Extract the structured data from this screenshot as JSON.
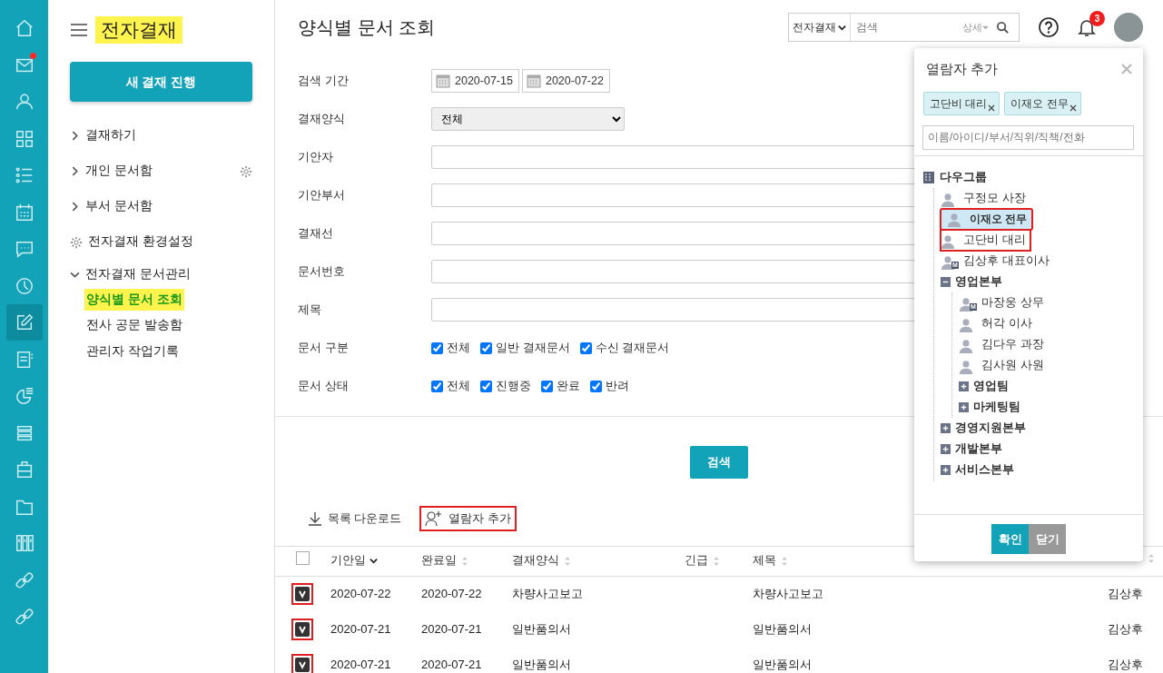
{
  "rail": [
    {
      "selected": false,
      "dot": false
    },
    {
      "selected": false,
      "dot": true
    },
    {
      "selected": false,
      "dot": false
    },
    {
      "selected": false,
      "dot": false
    },
    {
      "selected": false,
      "dot": false
    },
    {
      "selected": false,
      "dot": false
    },
    {
      "selected": false,
      "dot": false
    },
    {
      "selected": false,
      "dot": false
    },
    {
      "selected": true,
      "dot": false
    },
    {
      "selected": false,
      "dot": false
    },
    {
      "selected": false,
      "dot": false
    },
    {
      "selected": false,
      "dot": false
    },
    {
      "selected": false,
      "dot": false
    },
    {
      "selected": false,
      "dot": false
    },
    {
      "selected": false,
      "dot": false
    },
    {
      "selected": false,
      "dot": false
    },
    {
      "selected": false,
      "dot": false
    }
  ],
  "sidebar": {
    "title": "전자결재",
    "title_highlighted": true,
    "new_button": "새 결재 진행",
    "items": [
      {
        "kind": "folder",
        "label": "결재하기",
        "expanded": false
      },
      {
        "kind": "folder",
        "label": "개인 문서함",
        "expanded": false,
        "settings_button": true
      },
      {
        "kind": "folder",
        "label": "부서 문서함",
        "expanded": false
      },
      {
        "kind": "settings",
        "label": "전자결재 환경설정"
      },
      {
        "kind": "folder",
        "label": "전자결재 문서관리",
        "expanded": true,
        "children": [
          {
            "label": "양식별 문서 조회",
            "selected": true
          },
          {
            "label": "전사 공문 발송함",
            "selected": false
          },
          {
            "label": "관리자 작업기록",
            "selected": false
          }
        ]
      }
    ]
  },
  "header": {
    "title": "양식별 문서 조회",
    "search_scope": "전자결재",
    "search_placeholder": "검색",
    "detail": "상세",
    "notification_count": "3"
  },
  "form": [
    {
      "kind": "date_range",
      "label": "검색 기간",
      "from": "2020-07-15",
      "to": "2020-07-22"
    },
    {
      "kind": "select",
      "label": "결재양식",
      "value": "전체"
    },
    {
      "kind": "text",
      "label": "기안자"
    },
    {
      "kind": "text",
      "label": "기안부서"
    },
    {
      "kind": "text",
      "label": "결재선"
    },
    {
      "kind": "text",
      "label": "문서번호"
    },
    {
      "kind": "text",
      "label": "제목"
    },
    {
      "kind": "checkboxes",
      "label": "문서 구분",
      "options": [
        {
          "label": "전체",
          "checked": true
        },
        {
          "label": "일반 결재문서",
          "checked": true
        },
        {
          "label": "수신 결재문서",
          "checked": true
        }
      ]
    },
    {
      "kind": "checkboxes",
      "label": "문서 상태",
      "options": [
        {
          "label": "전체",
          "checked": true
        },
        {
          "label": "진행중",
          "checked": true
        },
        {
          "label": "완료",
          "checked": true
        },
        {
          "label": "반려",
          "checked": true
        }
      ]
    }
  ],
  "search_button": "검색",
  "toolbar": [
    {
      "kind": "download",
      "label": "목록 다운로드",
      "highlighted": false
    },
    {
      "kind": "add_viewer",
      "label": "열람자 추가",
      "highlighted": true
    }
  ],
  "table": {
    "all_checked": false,
    "columns": [
      {
        "label": "기안일",
        "sorted": true
      },
      {
        "label": "완료일",
        "sorted": false
      },
      {
        "label": "결재양식",
        "sorted": false
      },
      {
        "label": "긴급",
        "sorted": false
      },
      {
        "label": "제목",
        "sorted": false
      },
      {
        "sorted": false
      }
    ],
    "rows": [
      {
        "checked": true,
        "highlighted": true,
        "cells": [
          "2020-07-22",
          "2020-07-22",
          "차량사고보고",
          "",
          "차량사고보고",
          "김상후"
        ]
      },
      {
        "checked": true,
        "highlighted": true,
        "cells": [
          "2020-07-21",
          "2020-07-21",
          "일반품의서",
          "",
          "일반품의서",
          "김상후"
        ]
      },
      {
        "checked": true,
        "highlighted": true,
        "cells": [
          "2020-07-21",
          "2020-07-21",
          "일반품의서",
          "",
          "일반품의서",
          "김상후"
        ]
      }
    ]
  },
  "dialog": {
    "title": "열람자 추가",
    "tags": [
      "고단비 대리",
      "이재오 전무"
    ],
    "search_placeholder": "이름/아이디/부서/직위/직책/전화",
    "tree": [
      {
        "kind": "org",
        "label": "다우그룹",
        "children": [
          {
            "kind": "person",
            "label": "구정모 사장",
            "selected": false
          },
          {
            "kind": "person",
            "label": "이재오 전무",
            "selected": true,
            "highlighted": true
          },
          {
            "kind": "person",
            "label": "고단비 대리",
            "selected": false,
            "highlighted": true
          },
          {
            "kind": "manager",
            "label": "김상후 대표이사",
            "badge": "M",
            "selected": false
          },
          {
            "kind": "dept",
            "label": "영업본부",
            "expanded": true,
            "children": [
              {
                "kind": "manager",
                "label": "마장웅 상무",
                "badge": "M",
                "selected": false
              },
              {
                "kind": "person",
                "label": "허각 이사",
                "selected": false
              },
              {
                "kind": "person",
                "label": "김다우 과장",
                "selected": false
              },
              {
                "kind": "person",
                "label": "김사원 사원",
                "selected": false
              },
              {
                "kind": "dept",
                "label": "영업팀",
                "expanded": false
              },
              {
                "kind": "dept",
                "label": "마케팅팀",
                "expanded": false
              }
            ]
          },
          {
            "kind": "dept",
            "label": "경영지원본부",
            "expanded": false
          },
          {
            "kind": "dept",
            "label": "개발본부",
            "expanded": false
          },
          {
            "kind": "dept",
            "label": "서비스본부",
            "expanded": false
          }
        ]
      }
    ],
    "buttons": [
      {
        "kind": "primary",
        "label": "확인"
      },
      {
        "kind": "secondary",
        "label": "닫기"
      }
    ]
  }
}
